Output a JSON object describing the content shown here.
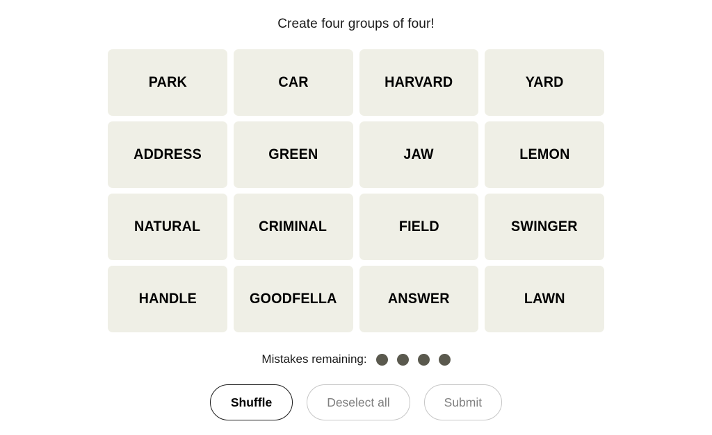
{
  "game": {
    "title": "Create four groups of four!",
    "tile_bg_color": "#EFEFE6",
    "page_bg_color": "#FFFFFF",
    "dot_color": "#5A594E",
    "active_border_color": "#1A1A1A",
    "disabled_border_color": "#C6C6C6",
    "disabled_text_color": "#7F7F7F"
  },
  "grid": {
    "rows": 4,
    "columns": 4,
    "tiles": [
      {
        "word": "PARK"
      },
      {
        "word": "CAR"
      },
      {
        "word": "HARVARD"
      },
      {
        "word": "YARD"
      },
      {
        "word": "ADDRESS"
      },
      {
        "word": "GREEN"
      },
      {
        "word": "JAW"
      },
      {
        "word": "LEMON"
      },
      {
        "word": "NATURAL"
      },
      {
        "word": "CRIMINAL"
      },
      {
        "word": "FIELD"
      },
      {
        "word": "SWINGER"
      },
      {
        "word": "HANDLE"
      },
      {
        "word": "GOODFELLA"
      },
      {
        "word": "ANSWER"
      },
      {
        "word": "LAWN"
      }
    ]
  },
  "mistakes": {
    "label": "Mistakes remaining:",
    "remaining": 4,
    "dots": [
      {
        "state": "filled"
      },
      {
        "state": "filled"
      },
      {
        "state": "filled"
      },
      {
        "state": "filled"
      }
    ]
  },
  "controls": {
    "shuffle_label": "Shuffle",
    "deselect_label": "Deselect all",
    "submit_label": "Submit"
  }
}
